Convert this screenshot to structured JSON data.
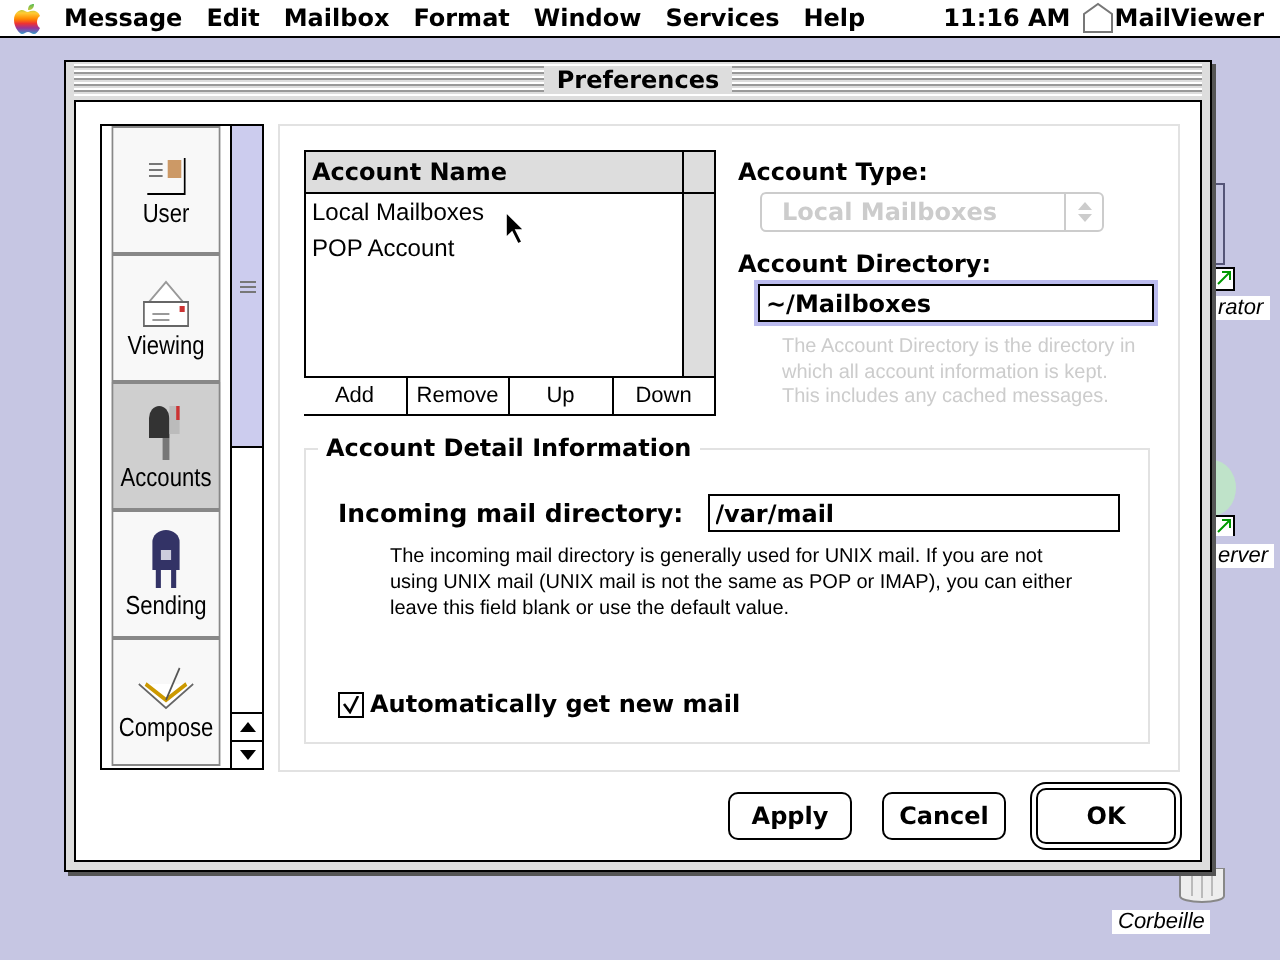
{
  "menubar": {
    "items": [
      "Message",
      "Edit",
      "Mailbox",
      "Format",
      "Window",
      "Services",
      "Help"
    ],
    "clock": "11:16 AM",
    "app": "MailViewer"
  },
  "desktop_icons": [
    {
      "label": "rator",
      "kind": "alias"
    },
    {
      "label": "erver",
      "kind": "globe"
    },
    {
      "label": "Corbeille",
      "kind": "trash"
    }
  ],
  "window": {
    "title": "Preferences"
  },
  "sidebar": {
    "items": [
      {
        "label": "User",
        "selected": false
      },
      {
        "label": "Viewing",
        "selected": false
      },
      {
        "label": "Accounts",
        "selected": true
      },
      {
        "label": "Sending",
        "selected": false
      },
      {
        "label": "Compose",
        "selected": false
      }
    ]
  },
  "accounts_table": {
    "column": "Account Name",
    "rows": [
      "Local Mailboxes",
      "POP Account"
    ],
    "buttons": [
      "Add",
      "Remove",
      "Up",
      "Down"
    ]
  },
  "account_type": {
    "label": "Account Type:",
    "value": "Local Mailboxes",
    "disabled": true
  },
  "account_directory": {
    "label": "Account Directory:",
    "value": "~/Mailboxes",
    "hint": "The Account Directory is the directory in which all account information is kept. This includes any cached messages."
  },
  "detail": {
    "title": "Account Detail Information",
    "incoming_label": "Incoming mail directory:",
    "incoming_value": "/var/mail",
    "description": "The incoming mail directory is generally used for UNIX mail.  If you are not using UNIX mail (UNIX mail is not the same as POP or IMAP), you can either leave this field blank or use the default value.",
    "auto_check": {
      "label": "Automatically get new mail",
      "checked": true
    }
  },
  "buttons": [
    {
      "label": "Apply",
      "default": false
    },
    {
      "label": "Cancel",
      "default": false
    },
    {
      "label": "OK",
      "default": true
    }
  ]
}
